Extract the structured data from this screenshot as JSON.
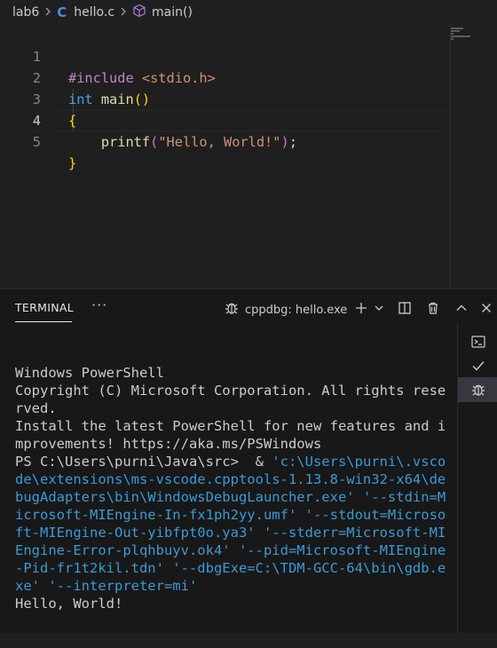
{
  "breadcrumb": {
    "folder": "lab6",
    "file": "hello.c",
    "symbol": "main()",
    "file_icon": "C",
    "symbol_icon": "cube-icon"
  },
  "editor": {
    "line_numbers": [
      "1",
      "2",
      "3",
      "4",
      "5"
    ],
    "line1": {
      "directive": "#include ",
      "header": "<stdio.h>"
    },
    "line2": {
      "type": "int",
      "name": " main",
      "paren": "()"
    },
    "line3": {
      "brace": "{"
    },
    "line4": {
      "indent": "    ",
      "fn": "printf",
      "open": "(",
      "str": "\"Hello, World!\"",
      "close": ")",
      "semi": ";"
    },
    "line5": {
      "brace": "}"
    }
  },
  "panel": {
    "tab_label": "TERMINAL",
    "more_label": "···",
    "session_label": "cppdbg: hello.exe",
    "icons": [
      "bug-icon",
      "plus-icon",
      "chevron-down-icon",
      "split-icon",
      "trash-icon",
      "chevron-up-icon",
      "close-icon"
    ]
  },
  "terminal": {
    "lines": [
      "Windows PowerShell",
      "Copyright (C) Microsoft Corporation. All rights rese",
      "rved.",
      "",
      "Install the latest PowerShell for new features and i",
      "mprovements! https://aka.ms/PSWindows",
      ""
    ],
    "prompt": "PS C:\\Users\\purni\\Java\\src>  & ",
    "command_lines": [
      "'c:\\Users\\purni\\.vsco",
      "de\\extensions\\ms-vscode.cpptools-1.13.8-win32-x64\\de",
      "bugAdapters\\bin\\WindowsDebugLauncher.exe' '--stdin=M",
      "icrosoft-MIEngine-In-fx1ph2yy.umf' '--stdout=Microso",
      "ft-MIEngine-Out-yibfpt0o.ya3' '--stderr=Microsoft-MI",
      "Engine-Error-plqhbuyv.ok4' '--pid=Microsoft-MIEngine",
      "-Pid-fr1t2kil.tdn' '--dbgExe=C:\\TDM-GCC-64\\bin\\gdb.e",
      "xe' '--interpreter=mi'"
    ],
    "output": "Hello, World!"
  },
  "side": {
    "items": [
      "terminal-icon",
      "check-icon",
      "bug-icon"
    ]
  }
}
